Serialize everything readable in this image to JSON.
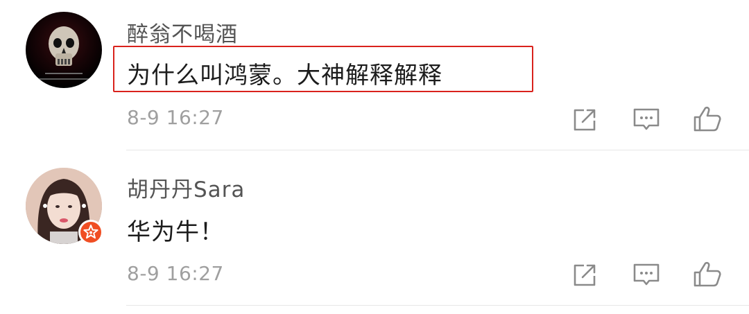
{
  "comments": [
    {
      "username": "醉翁不喝酒",
      "text": "为什么叫鸿蒙。大神解释解释",
      "time": "8-9 16:27",
      "highlighted": true,
      "avatar_icon": "skull-avatar"
    },
    {
      "username": "胡丹丹Sara",
      "text": "华为牛！",
      "time": "8-9 16:27",
      "highlighted": false,
      "avatar_icon": "girl-portrait-avatar",
      "badge_icon": "verified-star-badge"
    }
  ],
  "actions": {
    "share_icon": "share-icon",
    "comment_icon": "comment-icon",
    "like_icon": "like-icon"
  },
  "colors": {
    "username": "#545454",
    "text": "#1c1c1c",
    "time": "#9f9f9f",
    "icon": "#8a8a8a",
    "highlight_border": "#d9221c",
    "badge": "#f04e23",
    "divider": "#e6e6e6"
  }
}
